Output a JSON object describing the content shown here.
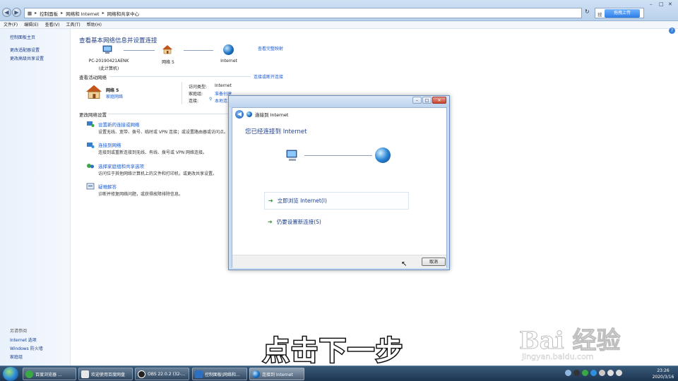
{
  "explorer": {
    "breadcrumb": [
      "控制面板",
      "网络和 Internet",
      "网络和共享中心"
    ],
    "search_placeholder": "搜",
    "upload_button": "拖拽上传",
    "menu": [
      "文件(F)",
      "编辑(E)",
      "查看(V)",
      "工具(T)",
      "帮助(H)"
    ],
    "left_links": [
      "控制面板主页",
      "更改适配器设置",
      "更改高级共享设置"
    ],
    "see_also_title": "另请参阅",
    "see_also": [
      "Internet 选项",
      "Windows 防火墙",
      "家庭组"
    ],
    "heading": "查看基本网络信息并设置连接",
    "full_map": "查看完整映射",
    "map": {
      "pc_name": "PC-20190421AENK",
      "pc_sub": "(此计算机)",
      "network": "网络  5",
      "internet": "Internet"
    },
    "active_title": "查看活动网络",
    "connect_disconnect": "连接或断开连接",
    "active_network": {
      "name": "网络  5",
      "type_link": "家庭网络",
      "access_label": "访问类型:",
      "access_value": "Internet",
      "homegroup_label": "家庭组:",
      "homegroup_value": "准备创建",
      "connection_label": "连接:",
      "connection_value": "本地连"
    },
    "change_title": "更改网络设置",
    "tasks": [
      {
        "link": "设置新的连接或网络",
        "desc": "设置无线、宽带、拨号、临时或 VPN 连接；或设置路由器或访问点。"
      },
      {
        "link": "连接到网络",
        "desc": "连接到或重新连接到无线、有线、拨号或 VPN 网络连接。"
      },
      {
        "link": "选择家庭组和共享选项",
        "desc": "访问位于其他网络计算机上的文件和打印机，或更改共享设置。"
      },
      {
        "link": "疑难解答",
        "desc": "诊断并修复网络问题，或获得故障排除信息。"
      }
    ]
  },
  "dialog": {
    "title": "连接到 Internet",
    "main_title": "您已经连接到 Internet",
    "option_browse": "立即浏览 Internet(I)",
    "option_new": "仍要设置新连接(S)",
    "cancel": "取消"
  },
  "overlay": {
    "subtitle": "点击下一步",
    "watermark": "Bai  经验",
    "watermark_url": "jingyan.baidu.com"
  },
  "taskbar": {
    "items": [
      "百度浏览器 ...",
      "欢迎使用百度网盘",
      "OBS 22.0.2 (32-...",
      "控制面板\\网络和...",
      "连接到 Internet"
    ],
    "time": "23:26",
    "date": "2020/3/16"
  },
  "colors": {
    "link": "#1a5bd0",
    "heading": "#1e3e8a",
    "taskbar": "#1c3450"
  }
}
